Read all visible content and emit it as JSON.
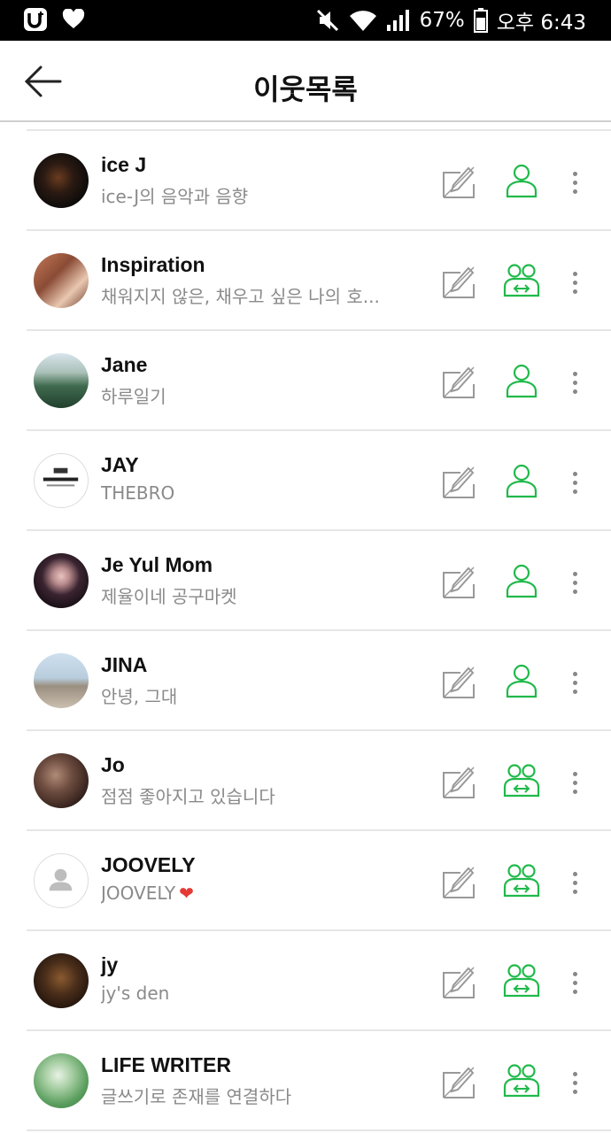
{
  "status_bar": {
    "carrier_icon": "uplus-logo-icon",
    "heart_icon": "heart-icon",
    "battery": "67%",
    "time": "오후 6:43"
  },
  "header": {
    "title": "이웃목록",
    "back_icon": "arrow-left-icon"
  },
  "colors": {
    "accent_green": "#20b94a",
    "muted_gray": "#8a8a8a",
    "heart_red": "#e53935"
  },
  "neighbors": [
    {
      "name": "ice J",
      "description": "ice-J의 음악과 음향",
      "relation": "neighbor"
    },
    {
      "name": "Inspiration",
      "description": "채워지지 않은, 채우고 싶은 나의 호...",
      "relation": "mutual"
    },
    {
      "name": "Jane",
      "description": "하루일기",
      "relation": "neighbor"
    },
    {
      "name": "JAY",
      "description": "THEBRO",
      "relation": "neighbor"
    },
    {
      "name": "Je Yul Mom",
      "description": "제율이네 공구마켓",
      "relation": "neighbor"
    },
    {
      "name": "JINA",
      "description": "안녕, 그대",
      "relation": "neighbor"
    },
    {
      "name": "Jo",
      "description": "점점 좋아지고 있습니다",
      "relation": "mutual"
    },
    {
      "name": "JOOVELY",
      "description": "JOOVELY",
      "relation": "mutual",
      "suffix": "❤"
    },
    {
      "name": "jy",
      "description": "jy's den",
      "relation": "mutual"
    },
    {
      "name": "LIFE WRITER",
      "description": "글쓰기로 존재를 연결하다",
      "relation": "mutual"
    }
  ]
}
